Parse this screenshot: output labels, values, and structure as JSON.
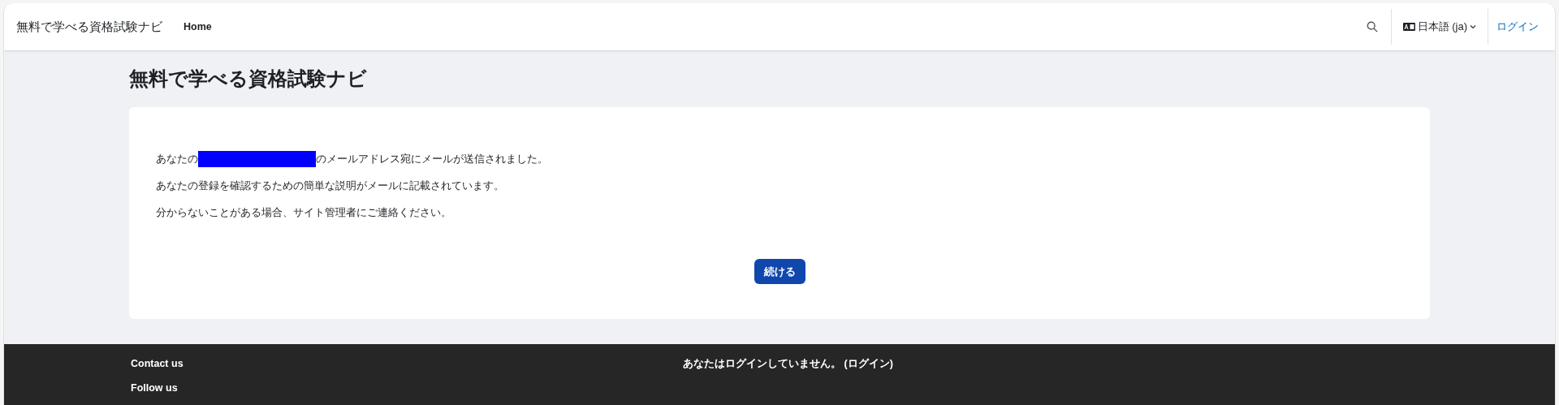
{
  "navbar": {
    "brand": "無料で学べる資格試験ナビ",
    "links": [
      {
        "label": "Home",
        "selected": true
      }
    ],
    "language": "日本語 (ja)",
    "login": "ログイン"
  },
  "page_title": "無料で学べる資格試験ナビ",
  "message": [
    {
      "kind": "redacted",
      "before": "あなたの",
      "after": "のメールアドレス宛にメールが送信されました。"
    },
    {
      "kind": "text",
      "text": "あなたの登録を確認するための簡単な説明がメールに記載されています。"
    },
    {
      "kind": "text",
      "text": "分からないことがある場合、サイト管理者にご連絡ください。"
    }
  ],
  "continue_button": "続ける",
  "footer": {
    "links": [
      "Contact us",
      "Follow us"
    ],
    "login_info": "あなたはログインしていません。 (ログイン)"
  }
}
